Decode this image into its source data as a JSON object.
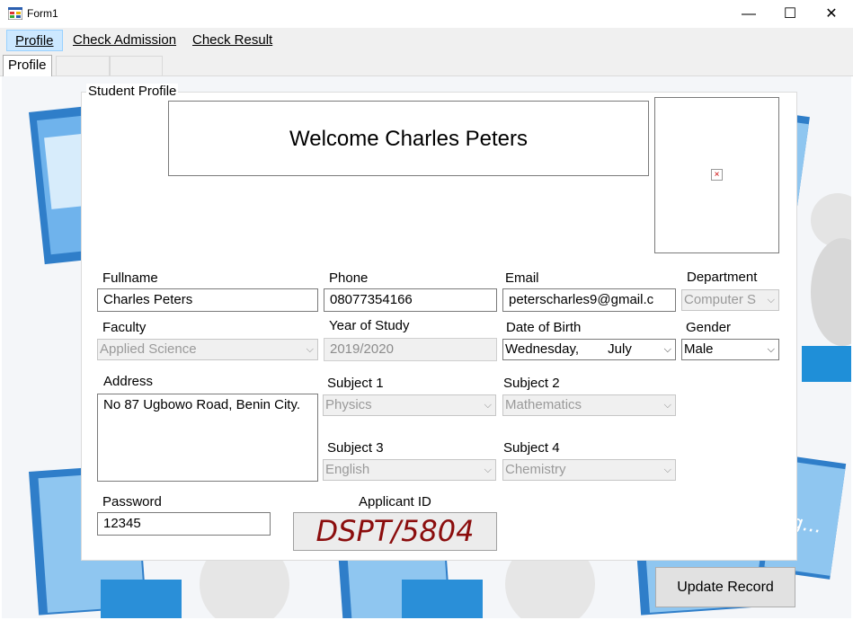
{
  "window": {
    "title": "Form1",
    "minimize": "—",
    "maximize": "☐",
    "close": "✕"
  },
  "menu": [
    {
      "label": "Profile"
    },
    {
      "label": "Check Admission"
    },
    {
      "label": "Check Result"
    }
  ],
  "tabs": {
    "selected": "Profile"
  },
  "group": {
    "legend": "Student Profile"
  },
  "welcome": "Welcome Charles Peters",
  "form": {
    "fullname": {
      "label": "Fullname",
      "value": "Charles Peters"
    },
    "phone": {
      "label": "Phone",
      "value": "08077354166"
    },
    "email": {
      "label": "Email",
      "value": "peterscharles9@gmail.c"
    },
    "department": {
      "label": "Department",
      "value": "Computer S"
    },
    "faculty": {
      "label": "Faculty",
      "value": "Applied Science"
    },
    "year_of_study": {
      "label": "Year of Study",
      "value": "2019/2020"
    },
    "date_of_birth": {
      "label": "Date of Birth",
      "day": "Wednesday,",
      "month": "July"
    },
    "gender": {
      "label": "Gender",
      "value": "Male"
    },
    "address": {
      "label": "Address",
      "value": "No 87 Ugbowo Road, Benin City."
    },
    "subject1": {
      "label": "Subject 1",
      "value": "Physics"
    },
    "subject2": {
      "label": "Subject 2",
      "value": "Mathematics"
    },
    "subject3": {
      "label": "Subject 3",
      "value": "English"
    },
    "subject4": {
      "label": "Subject 4",
      "value": "Chemistry"
    },
    "password": {
      "label": "Password",
      "value": "12345"
    },
    "applicant_id": {
      "label": "Applicant ID",
      "value": "DSPT/5804"
    }
  },
  "buttons": {
    "update": "Update Record"
  },
  "icons": {
    "app": "windows-form-icon",
    "photo": "broken-image-icon",
    "dropdown": "chevron-down-icon"
  },
  "colors": {
    "menu_active_bg": "#cce8ff",
    "applicant_id_text": "#8b0d0d"
  }
}
